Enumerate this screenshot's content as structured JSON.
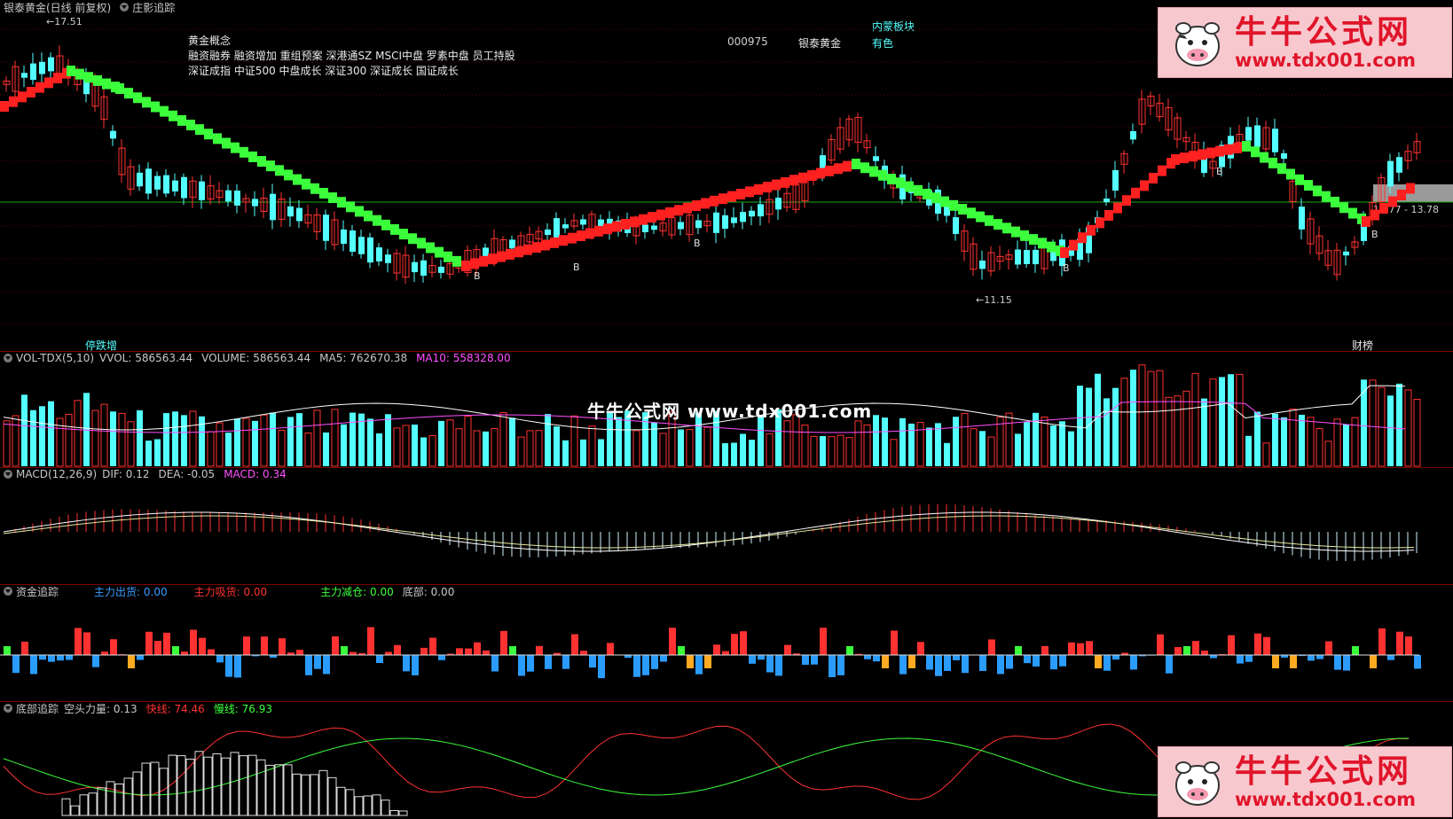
{
  "header": {
    "title": "银泰黄金(日线 前复权)",
    "indicator": "庄影追踪"
  },
  "info": {
    "concept_title": "黄金概念",
    "concept_line1": "融资融券 融资增加 重组预案 深港通SZ MSCI中盘 罗素中盘 员工持股",
    "concept_line2": "深证成指 中证500 中盘成长 深证300 深证成长 国证成长",
    "code": "000975",
    "name": "银泰黄金",
    "region": "内蒙板块",
    "sector": "有色"
  },
  "price_labels": {
    "high": "17.51",
    "low": "11.15",
    "right_label": "13.77 - 13.78",
    "buy_mark": "B"
  },
  "tags": {
    "left": "停跌增",
    "right": "财榜"
  },
  "vol": {
    "name": "VOL-TDX(5,10)",
    "vvol": "VVOL: 586563.44",
    "volume": "VOLUME: 586563.44",
    "ma5": "MA5: 762670.38",
    "ma10": "MA10: 558328.00"
  },
  "macd": {
    "name": "MACD(12,26,9)",
    "dif": "DIF: 0.12",
    "dea": "DEA: -0.05",
    "macd": "MACD: 0.34"
  },
  "fund": {
    "name": "资金追踪",
    "out": "主力出货: 0.00",
    "in": "主力吸货: 0.00",
    "reduce": "主力减仓: 0.00",
    "bottom": "底部: 0.00"
  },
  "bottom": {
    "name": "底部追踪",
    "short_power": "空头力量: 0.13",
    "fast": "快线: 74.46",
    "slow": "慢线: 76.93"
  },
  "watermark": {
    "center": "牛牛公式网 www.tdx001.com",
    "logo_cn": "牛牛公式网",
    "logo_url": "www.tdx001.com"
  },
  "colors": {
    "up": "#ff3232",
    "down": "#54ffff",
    "trend_up": "#ff2020",
    "trend_down": "#3cff3c",
    "ma10": "#ff50ff",
    "bg": "#000000"
  }
}
